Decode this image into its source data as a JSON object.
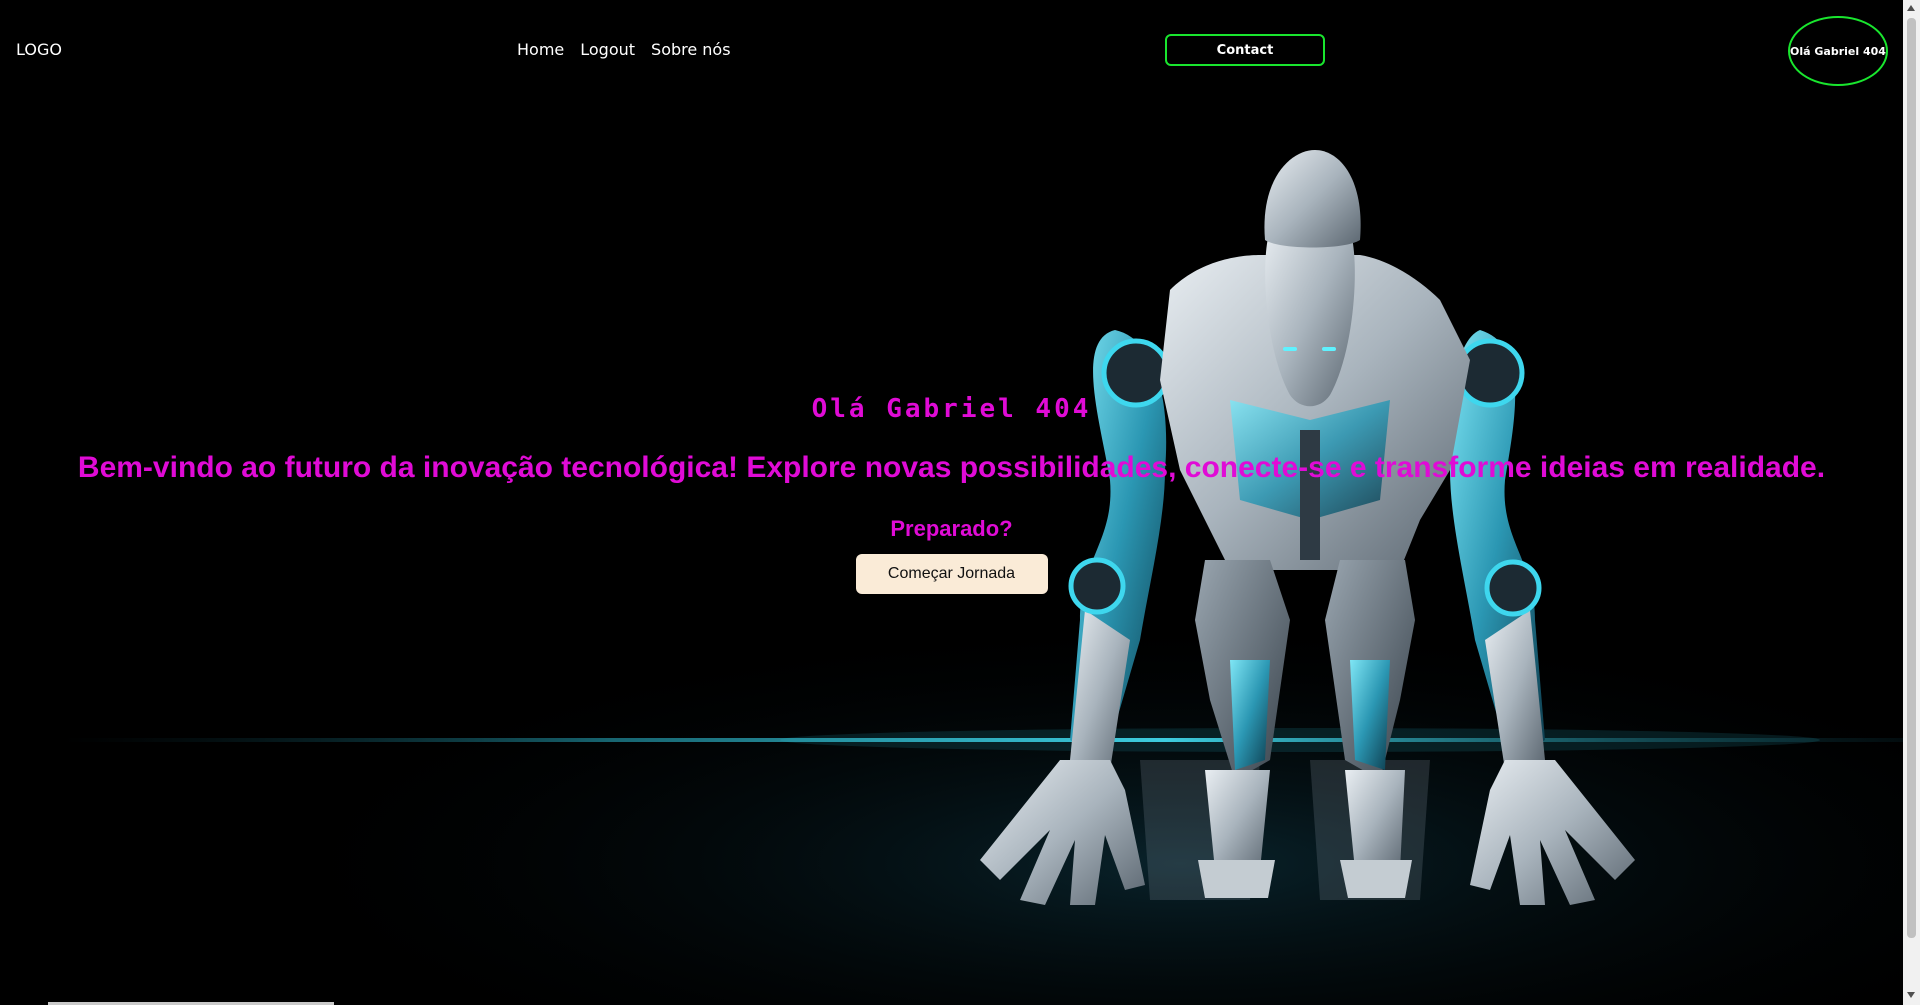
{
  "header": {
    "logo": "LOGO",
    "nav": [
      "Home",
      "Logout",
      "Sobre nós"
    ],
    "contact_label": "Contact",
    "user_label": "Olá Gabriel 404"
  },
  "hero": {
    "greeting": "Olá Gabriel 404",
    "headline": "Bem-vindo ao futuro da inovação tecnológica! Explore novas possibilidades, conecte-se e transforme ideias em realidade.",
    "question": "Preparado?",
    "cta_label": "Começar Jornada"
  },
  "colors": {
    "accent_pink": "#e00bd6",
    "accent_green": "#19e62e",
    "cta_bg": "#faebd7",
    "background": "#000000",
    "glow_cyan": "#2fd8ef"
  },
  "icons": {
    "hero_art": "robot-illustration"
  }
}
